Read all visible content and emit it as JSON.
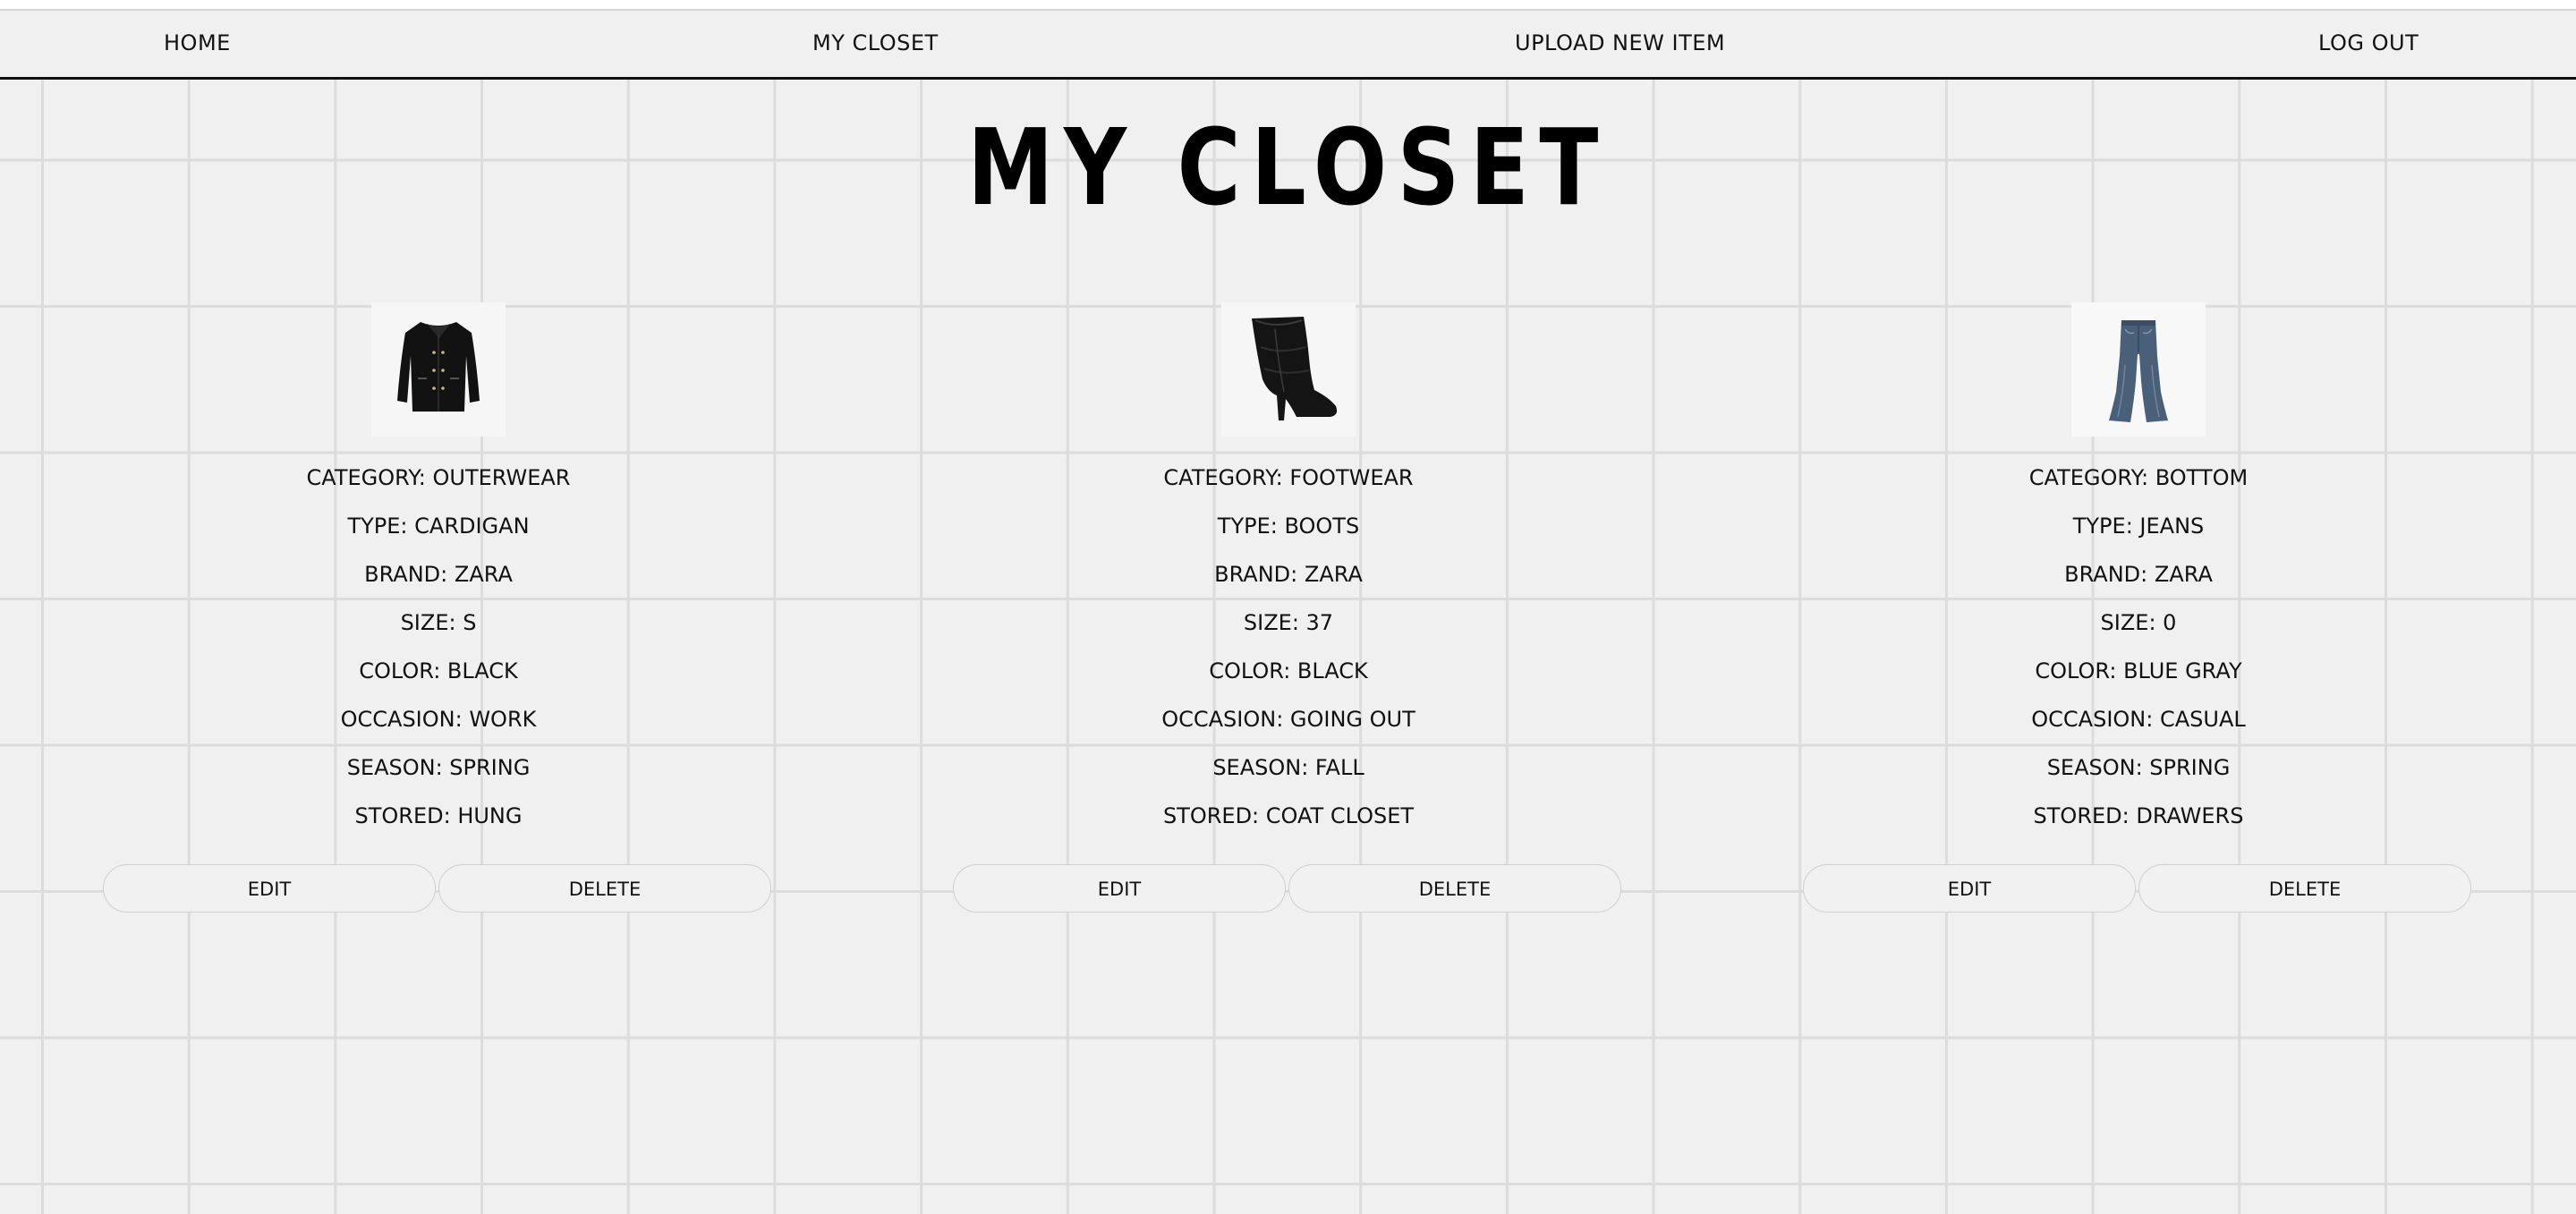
{
  "nav": {
    "home": "HOME",
    "my_closet": "MY CLOSET",
    "upload": "UPLOAD NEW ITEM",
    "logout": "LOG OUT"
  },
  "page_title": "MY CLOSET",
  "items": [
    {
      "image_icon": "black-cardigan-jacket",
      "category": "CATEGORY: OUTERWEAR",
      "type": "TYPE: CARDIGAN",
      "brand": "BRAND: ZARA",
      "size": "SIZE: S",
      "color": "COLOR: BLACK",
      "occasion": "OCCASION: WORK",
      "season": "SEASON: SPRING",
      "stored": "STORED: HUNG",
      "edit_label": "EDIT",
      "delete_label": "DELETE"
    },
    {
      "image_icon": "black-leather-boots",
      "category": "CATEGORY: FOOTWEAR",
      "type": "TYPE: BOOTS",
      "brand": "BRAND: ZARA",
      "size": "SIZE: 37",
      "color": "COLOR: BLACK",
      "occasion": "OCCASION: GOING OUT",
      "season": "SEASON: FALL",
      "stored": "STORED: COAT CLOSET",
      "edit_label": "EDIT",
      "delete_label": "DELETE"
    },
    {
      "image_icon": "blue-gray-flared-jeans",
      "category": "CATEGORY: BOTTOM",
      "type": "TYPE: JEANS",
      "brand": "BRAND: ZARA",
      "size": "SIZE: 0",
      "color": "COLOR: BLUE GRAY",
      "occasion": "OCCASION: CASUAL",
      "season": "SEASON: SPRING",
      "stored": "STORED: DRAWERS",
      "edit_label": "EDIT",
      "delete_label": "DELETE"
    }
  ],
  "colors": {
    "background": "#f0f0f0",
    "grid_line": "#dcdcdc",
    "text": "#111111",
    "button_border": "#cfcfcf"
  }
}
